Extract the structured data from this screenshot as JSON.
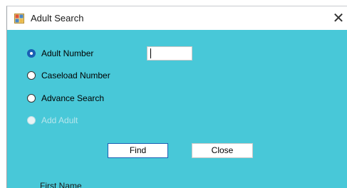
{
  "window": {
    "title": "Adult Search",
    "close_glyph": "✕",
    "client_color": "#48c8d8"
  },
  "search_options": [
    {
      "label": "Adult Number",
      "selected": true,
      "enabled": true
    },
    {
      "label": "Caseload Number",
      "selected": false,
      "enabled": true
    },
    {
      "label": "Advance Search",
      "selected": false,
      "enabled": true
    },
    {
      "label": "Add Adult",
      "selected": false,
      "enabled": false
    }
  ],
  "adult_number_input": {
    "value": ""
  },
  "buttons": {
    "find_label": "Find",
    "close_label": "Close"
  },
  "partial_label": "First Name",
  "icons": {
    "app": "app-window-icon",
    "close": "close-icon"
  }
}
